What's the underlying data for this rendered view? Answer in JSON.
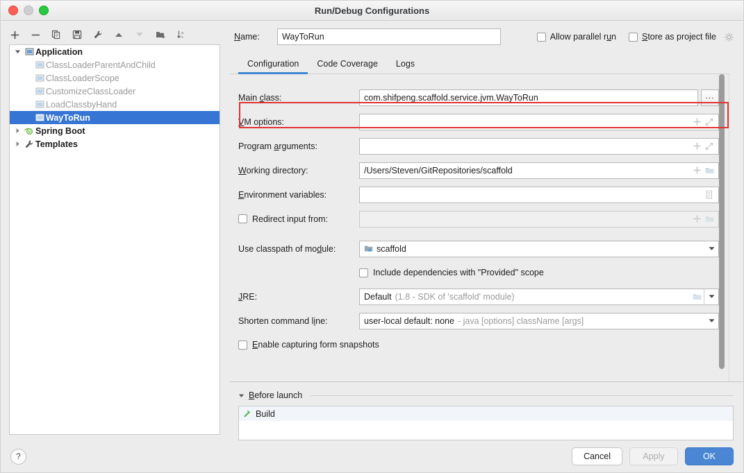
{
  "window": {
    "title": "Run/Debug Configurations",
    "traffic_lights": [
      "close-red",
      "minimize-gray",
      "zoom-green"
    ]
  },
  "toolbar": {
    "buttons": [
      {
        "name": "add",
        "icon": "plus-icon",
        "enabled": true
      },
      {
        "name": "remove",
        "icon": "minus-icon",
        "enabled": true
      },
      {
        "name": "copy",
        "icon": "copy-icon",
        "enabled": true
      },
      {
        "name": "save",
        "icon": "save-icon",
        "enabled": true
      },
      {
        "name": "edit-templates",
        "icon": "wrench-icon",
        "enabled": true
      },
      {
        "name": "move-up",
        "icon": "arrow-up-icon",
        "enabled": true
      },
      {
        "name": "move-down",
        "icon": "arrow-down-icon",
        "enabled": false
      },
      {
        "name": "new-folder",
        "icon": "folder-add-icon",
        "enabled": true
      },
      {
        "name": "sort-alphabetically",
        "icon": "sort-az-icon",
        "enabled": true
      }
    ]
  },
  "tree": {
    "nodes": [
      {
        "label": "Application",
        "level": 0,
        "bold": true,
        "expanded": true,
        "icon": "run-config-icon",
        "selected": false
      },
      {
        "label": "ClassLoaderParentAndChild",
        "level": 1,
        "bold": false,
        "muted": true,
        "icon": "run-config-icon",
        "selected": false
      },
      {
        "label": "ClassLoaderScope",
        "level": 1,
        "bold": false,
        "muted": true,
        "icon": "run-config-icon",
        "selected": false
      },
      {
        "label": "CustomizeClassLoader",
        "level": 1,
        "bold": false,
        "muted": true,
        "icon": "run-config-icon",
        "selected": false
      },
      {
        "label": "LoadClassbyHand",
        "level": 1,
        "bold": false,
        "muted": true,
        "icon": "run-config-icon",
        "selected": false
      },
      {
        "label": "WayToRun",
        "level": 1,
        "bold": true,
        "muted": false,
        "icon": "run-config-icon",
        "selected": true
      },
      {
        "label": "Spring Boot",
        "level": 0,
        "bold": true,
        "expanded": false,
        "icon": "spring-boot-icon",
        "selected": false
      },
      {
        "label": "Templates",
        "level": 0,
        "bold": true,
        "expanded": false,
        "icon": "wrench-icon",
        "selected": false
      }
    ]
  },
  "header": {
    "name_label": "Name:",
    "name_value": "WayToRun",
    "allow_parallel_run": {
      "label": "Allow parallel run",
      "checked": false
    },
    "store_as_project_file": {
      "label": "Store as project file",
      "checked": false
    },
    "gear_icon": "gear-icon"
  },
  "tabs": [
    {
      "label": "Configuration",
      "active": true
    },
    {
      "label": "Code Coverage",
      "active": false
    },
    {
      "label": "Logs",
      "active": false
    }
  ],
  "form": {
    "main_class": {
      "label": "Main class:",
      "value": "com.shifpeng.scaffold.service.jvm.WayToRun",
      "browse_label": "..."
    },
    "vm_options": {
      "label": "VM options:",
      "value": "",
      "highlighted": true,
      "highlight_color": "#e03131"
    },
    "program_arguments": {
      "label": "Program arguments:",
      "value": ""
    },
    "working_directory": {
      "label": "Working directory:",
      "value": "/Users/Steven/GitRepositories/scaffold"
    },
    "environment_variables": {
      "label": "Environment variables:",
      "value": ""
    },
    "redirect_input_from": {
      "label": "Redirect input from:",
      "checked": false,
      "value": "",
      "disabled": true
    },
    "use_classpath_of_module": {
      "label": "Use classpath of module:",
      "value": "scaffold",
      "icon": "module-icon"
    },
    "include_provided_scope": {
      "label": "Include dependencies with \"Provided\" scope",
      "checked": false
    },
    "jre": {
      "label": "JRE:",
      "value": "Default",
      "value_hint": "(1.8 - SDK of 'scaffold' module)"
    },
    "shorten_command_line": {
      "label": "Shorten command line:",
      "value": "user-local default: none",
      "value_hint": "- java [options] className [args]"
    },
    "enable_form_snapshots": {
      "label": "Enable capturing form snapshots",
      "checked": false
    }
  },
  "before_launch": {
    "title": "Before launch",
    "expanded": true,
    "items": [
      {
        "label": "Build",
        "icon": "build-hammer-icon"
      }
    ]
  },
  "footer": {
    "help_label": "?",
    "cancel_label": "Cancel",
    "apply_label": "Apply",
    "apply_enabled": false,
    "ok_label": "OK",
    "ok_color": "#4a86d4"
  }
}
